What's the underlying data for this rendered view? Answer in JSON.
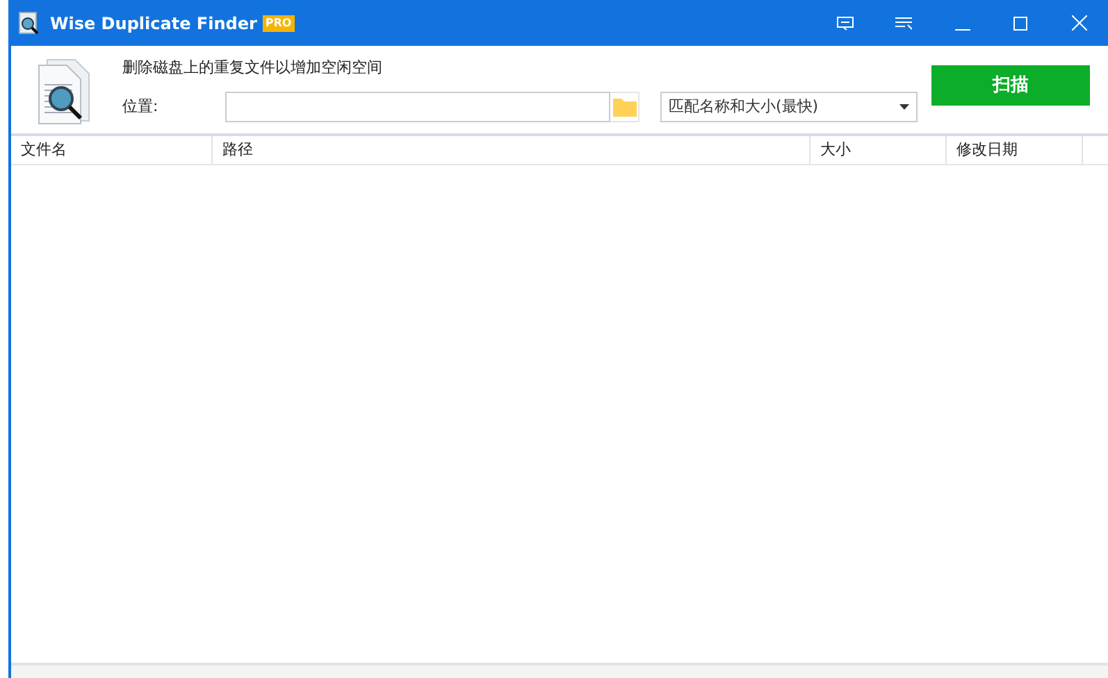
{
  "window": {
    "title": "Wise Duplicate Finder",
    "badge": "PRO"
  },
  "header": {
    "description": "删除磁盘上的重复文件以增加空闲空间",
    "location_label": "位置:",
    "match_mode": "匹配名称和大小(最快)",
    "scan_button": "扫描"
  },
  "table": {
    "columns": [
      "文件名",
      "路径",
      "大小",
      "修改日期"
    ]
  }
}
